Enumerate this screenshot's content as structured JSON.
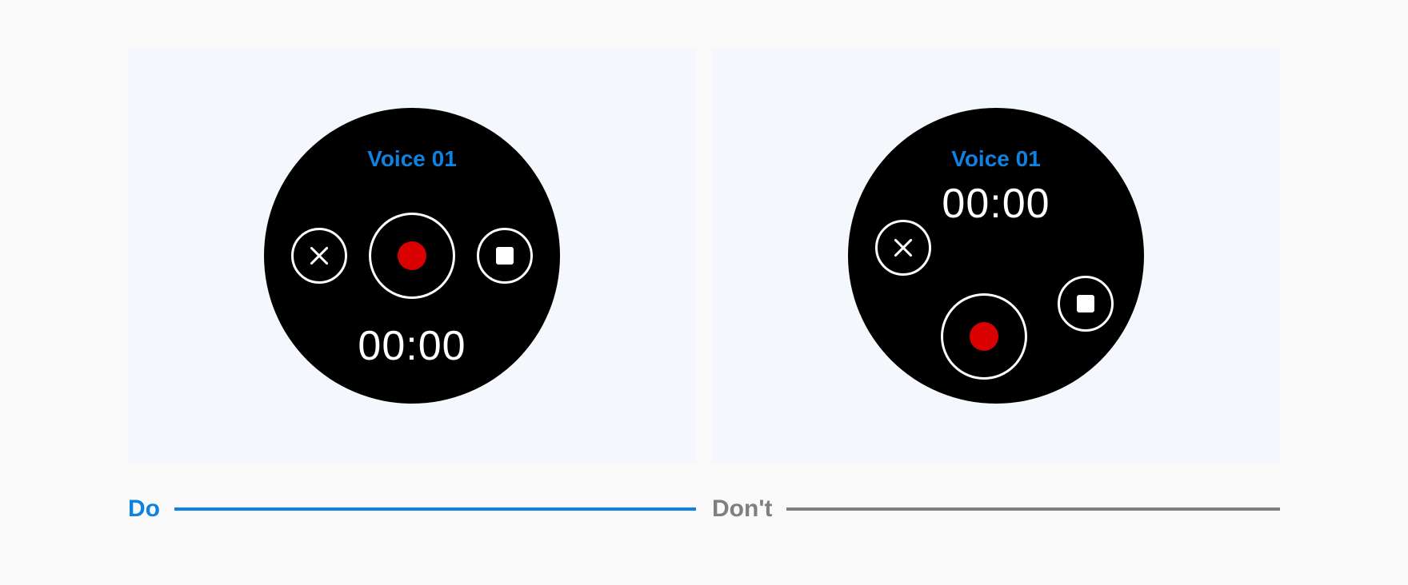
{
  "colors": {
    "accent_blue": "#0f81e0",
    "neutral_grey": "#7f7f7f",
    "record_red": "#d80000",
    "face_bg": "#000000",
    "panel_bg": "#f4f8fc"
  },
  "do_example": {
    "caption": "Do",
    "face": {
      "title": "Voice 01",
      "timer": "00:00",
      "buttons": {
        "cancel": "close-icon",
        "record": "record-icon",
        "stop": "stop-icon"
      }
    }
  },
  "dont_example": {
    "caption": "Don't",
    "face": {
      "title": "Voice 01",
      "timer": "00:00",
      "buttons": {
        "cancel": "close-icon",
        "record": "record-icon",
        "stop": "stop-icon"
      }
    }
  }
}
